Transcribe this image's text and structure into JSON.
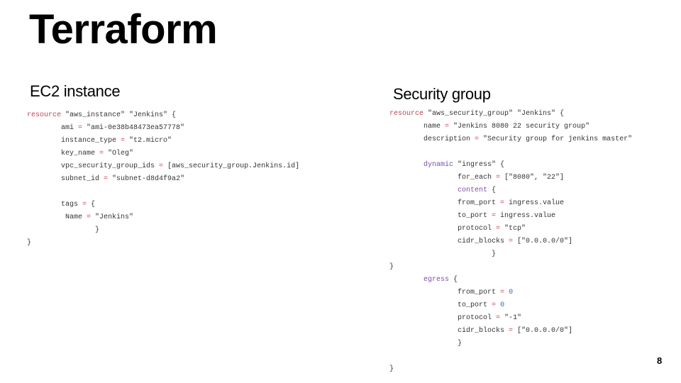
{
  "title": "Terraform",
  "left": {
    "heading": "EC2 instance",
    "code": [
      [
        [
          "k",
          "resource"
        ],
        [
          "d",
          " \"aws_instance\" \"Jenkins\" {"
        ]
      ],
      [
        [
          "d",
          "        ami "
        ],
        [
          "o",
          "="
        ],
        [
          "d",
          " \"ami-0e38b48473ea57778\""
        ]
      ],
      [
        [
          "d",
          "        instance_type "
        ],
        [
          "o",
          "="
        ],
        [
          "d",
          " \"t2.micro\""
        ]
      ],
      [
        [
          "d",
          "        key_name "
        ],
        [
          "o",
          "="
        ],
        [
          "d",
          " \"Oleg\""
        ]
      ],
      [
        [
          "d",
          "        vpc_security_group_ids "
        ],
        [
          "o",
          "="
        ],
        [
          "d",
          " [aws_security_group.Jenkins.id]"
        ]
      ],
      [
        [
          "d",
          "        subnet_id "
        ],
        [
          "o",
          "="
        ],
        [
          "d",
          " \"subnet-d8d4f9a2\""
        ]
      ],
      [
        [
          "d",
          ""
        ]
      ],
      [
        [
          "d",
          "        tags "
        ],
        [
          "o",
          "="
        ],
        [
          "d",
          " {"
        ]
      ],
      [
        [
          "d",
          "         Name "
        ],
        [
          "o",
          "="
        ],
        [
          "d",
          " \"Jenkins\""
        ]
      ],
      [
        [
          "d",
          "                }"
        ]
      ],
      [
        [
          "d",
          "}"
        ]
      ]
    ]
  },
  "right": {
    "heading": "Security group",
    "code": [
      [
        [
          "k",
          "resource"
        ],
        [
          "d",
          " \"aws_security_group\" \"Jenkins\" {"
        ]
      ],
      [
        [
          "d",
          "        name "
        ],
        [
          "o",
          "="
        ],
        [
          "d",
          " \"Jenkins 8080 22 security group\""
        ]
      ],
      [
        [
          "d",
          "        description "
        ],
        [
          "o",
          "="
        ],
        [
          "d",
          " \"Security group for jenkins master\""
        ]
      ],
      [
        [
          "d",
          ""
        ]
      ],
      [
        [
          "d",
          "        "
        ],
        [
          "p",
          "dynamic"
        ],
        [
          "d",
          " \"ingress\" {"
        ]
      ],
      [
        [
          "d",
          "                for_each "
        ],
        [
          "o",
          "="
        ],
        [
          "d",
          " [\"8080\", \"22\"]"
        ]
      ],
      [
        [
          "d",
          "                "
        ],
        [
          "p",
          "content"
        ],
        [
          "d",
          " {"
        ]
      ],
      [
        [
          "d",
          "                from_port "
        ],
        [
          "o",
          "="
        ],
        [
          "d",
          " ingress.value"
        ]
      ],
      [
        [
          "d",
          "                to_port "
        ],
        [
          "o",
          "="
        ],
        [
          "d",
          " ingress.value"
        ]
      ],
      [
        [
          "d",
          "                protocol "
        ],
        [
          "o",
          "="
        ],
        [
          "d",
          " \"tcp\""
        ]
      ],
      [
        [
          "d",
          "                cidr_blocks "
        ],
        [
          "o",
          "="
        ],
        [
          "d",
          " [\"0.0.0.0/0\"]"
        ]
      ],
      [
        [
          "d",
          "                        }"
        ]
      ],
      [
        [
          "d",
          "}"
        ]
      ],
      [
        [
          "d",
          "        "
        ],
        [
          "p",
          "egress"
        ],
        [
          "d",
          " {"
        ]
      ],
      [
        [
          "d",
          "                from_port "
        ],
        [
          "o",
          "="
        ],
        [
          "d",
          " "
        ],
        [
          "n",
          "0"
        ]
      ],
      [
        [
          "d",
          "                to_port "
        ],
        [
          "o",
          "="
        ],
        [
          "d",
          " "
        ],
        [
          "n",
          "0"
        ]
      ],
      [
        [
          "d",
          "                protocol "
        ],
        [
          "o",
          "="
        ],
        [
          "d",
          " \"-1\""
        ]
      ],
      [
        [
          "d",
          "                cidr_blocks "
        ],
        [
          "o",
          "="
        ],
        [
          "d",
          " [\"0.0.0.0/0\"]"
        ]
      ],
      [
        [
          "d",
          "                }"
        ]
      ],
      [
        [
          "d",
          ""
        ]
      ],
      [
        [
          "d",
          "}"
        ]
      ]
    ]
  },
  "page_number": "8",
  "colors": {
    "keyword": "#c0455a",
    "operator": "#d0404a",
    "block": "#7a4fa8",
    "number": "#2b6cc4",
    "text": "#333333"
  }
}
